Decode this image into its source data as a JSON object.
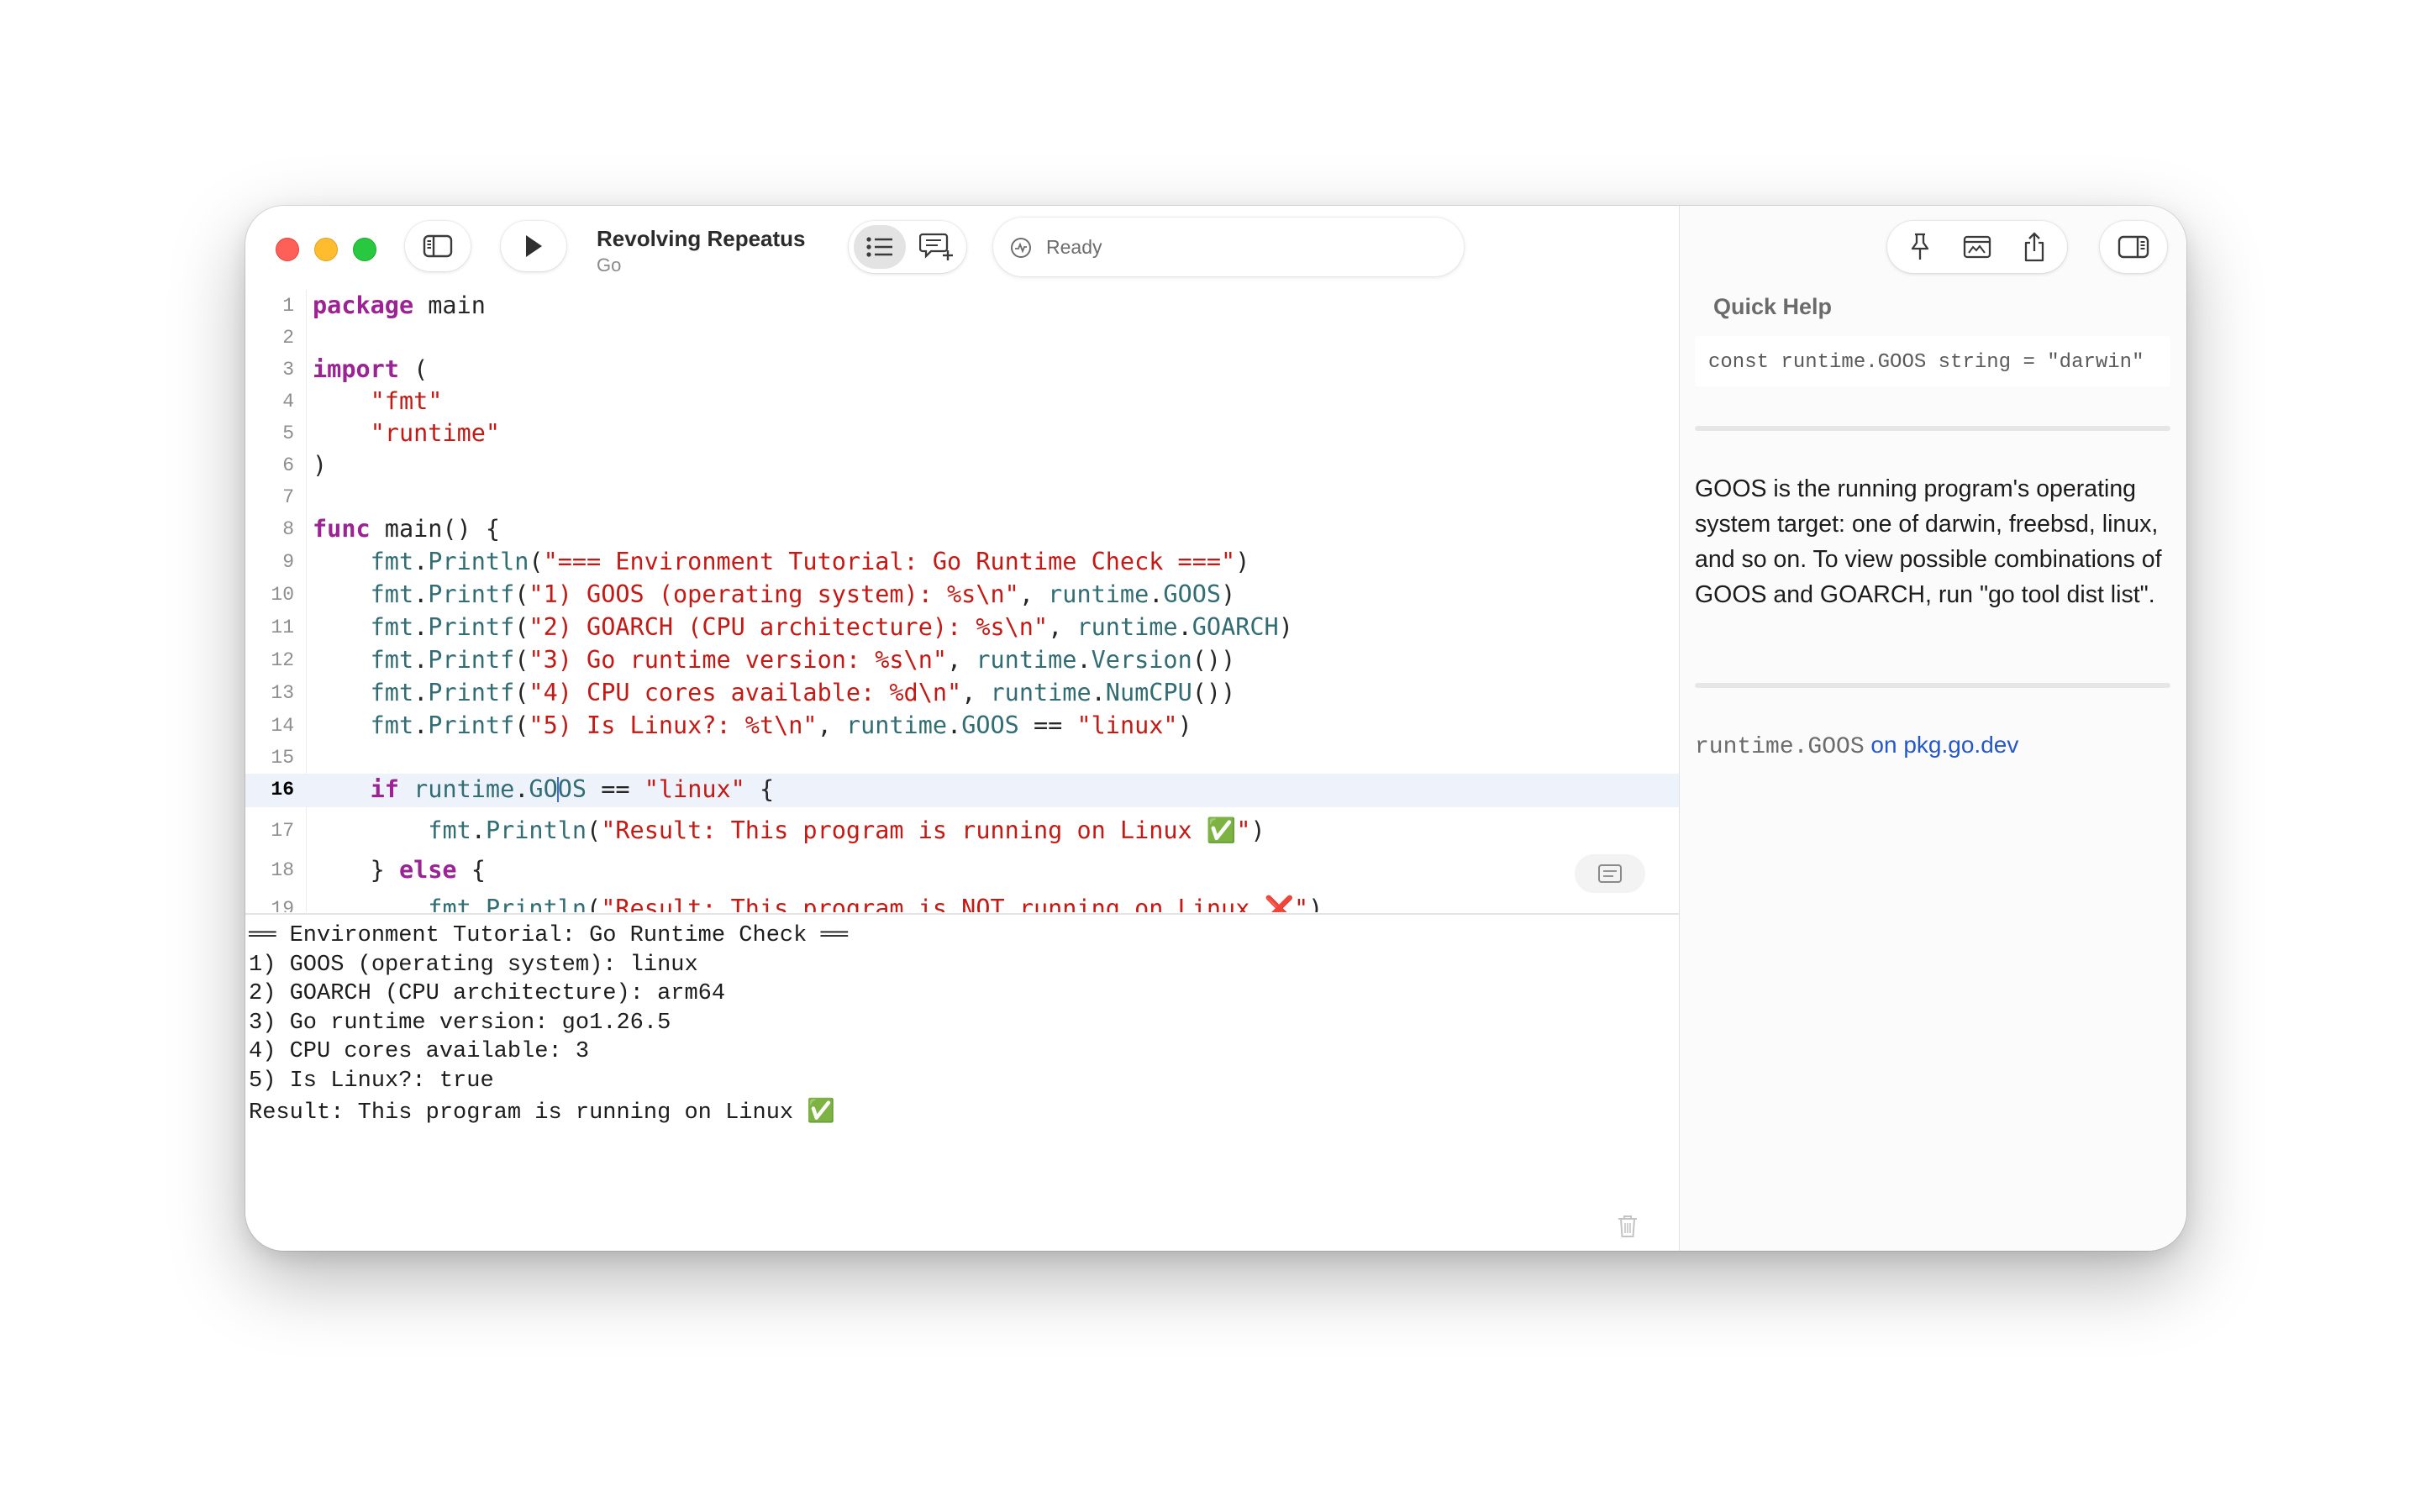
{
  "window": {
    "title": "Revolving Repeatus",
    "subtitle": "Go",
    "status": "Ready"
  },
  "editor": {
    "current_line": 16,
    "lines": [
      {
        "n": "1",
        "parts": [
          {
            "t": "package",
            "c": "kw"
          },
          {
            "t": " main"
          }
        ]
      },
      {
        "n": "2",
        "parts": []
      },
      {
        "n": "3",
        "parts": [
          {
            "t": "import",
            "c": "kw"
          },
          {
            "t": " ("
          }
        ]
      },
      {
        "n": "4",
        "parts": [
          {
            "t": "    "
          },
          {
            "t": "\"fmt\"",
            "c": "str"
          }
        ]
      },
      {
        "n": "5",
        "parts": [
          {
            "t": "    "
          },
          {
            "t": "\"runtime\"",
            "c": "str"
          }
        ]
      },
      {
        "n": "6",
        "parts": [
          {
            "t": ")"
          }
        ]
      },
      {
        "n": "7",
        "parts": []
      },
      {
        "n": "8",
        "parts": [
          {
            "t": "func",
            "c": "kw"
          },
          {
            "t": " main() {"
          }
        ]
      },
      {
        "n": "9",
        "parts": [
          {
            "t": "    "
          },
          {
            "t": "fmt",
            "c": "id"
          },
          {
            "t": "."
          },
          {
            "t": "Println",
            "c": "id"
          },
          {
            "t": "("
          },
          {
            "t": "\"=== Environment Tutorial: Go Runtime Check ===\"",
            "c": "str"
          },
          {
            "t": ")"
          }
        ]
      },
      {
        "n": "10",
        "parts": [
          {
            "t": "    "
          },
          {
            "t": "fmt",
            "c": "id"
          },
          {
            "t": "."
          },
          {
            "t": "Printf",
            "c": "id"
          },
          {
            "t": "("
          },
          {
            "t": "\"1) GOOS (operating system): %s\\n\"",
            "c": "str"
          },
          {
            "t": ", "
          },
          {
            "t": "runtime",
            "c": "id"
          },
          {
            "t": "."
          },
          {
            "t": "GOOS",
            "c": "id"
          },
          {
            "t": ")"
          }
        ]
      },
      {
        "n": "11",
        "parts": [
          {
            "t": "    "
          },
          {
            "t": "fmt",
            "c": "id"
          },
          {
            "t": "."
          },
          {
            "t": "Printf",
            "c": "id"
          },
          {
            "t": "("
          },
          {
            "t": "\"2) GOARCH (CPU architecture): %s\\n\"",
            "c": "str"
          },
          {
            "t": ", "
          },
          {
            "t": "runtime",
            "c": "id"
          },
          {
            "t": "."
          },
          {
            "t": "GOARCH",
            "c": "id"
          },
          {
            "t": ")"
          }
        ]
      },
      {
        "n": "12",
        "parts": [
          {
            "t": "    "
          },
          {
            "t": "fmt",
            "c": "id"
          },
          {
            "t": "."
          },
          {
            "t": "Printf",
            "c": "id"
          },
          {
            "t": "("
          },
          {
            "t": "\"3) Go runtime version: %s\\n\"",
            "c": "str"
          },
          {
            "t": ", "
          },
          {
            "t": "runtime",
            "c": "id"
          },
          {
            "t": "."
          },
          {
            "t": "Version",
            "c": "id"
          },
          {
            "t": "())"
          }
        ]
      },
      {
        "n": "13",
        "parts": [
          {
            "t": "    "
          },
          {
            "t": "fmt",
            "c": "id"
          },
          {
            "t": "."
          },
          {
            "t": "Printf",
            "c": "id"
          },
          {
            "t": "("
          },
          {
            "t": "\"4) CPU cores available: %d\\n\"",
            "c": "str"
          },
          {
            "t": ", "
          },
          {
            "t": "runtime",
            "c": "id"
          },
          {
            "t": "."
          },
          {
            "t": "NumCPU",
            "c": "id"
          },
          {
            "t": "())"
          }
        ]
      },
      {
        "n": "14",
        "parts": [
          {
            "t": "    "
          },
          {
            "t": "fmt",
            "c": "id"
          },
          {
            "t": "."
          },
          {
            "t": "Printf",
            "c": "id"
          },
          {
            "t": "("
          },
          {
            "t": "\"5) Is Linux?: %t\\n\"",
            "c": "str"
          },
          {
            "t": ", "
          },
          {
            "t": "runtime",
            "c": "id"
          },
          {
            "t": "."
          },
          {
            "t": "GOOS",
            "c": "id"
          },
          {
            "t": " == "
          },
          {
            "t": "\"linux\"",
            "c": "str"
          },
          {
            "t": ")"
          }
        ]
      },
      {
        "n": "15",
        "parts": []
      },
      {
        "n": "16",
        "parts": [
          {
            "t": "    "
          },
          {
            "t": "if",
            "c": "kw"
          },
          {
            "t": " "
          },
          {
            "t": "runtime",
            "c": "id"
          },
          {
            "t": "."
          },
          {
            "t": "GO",
            "c": "id"
          },
          {
            "caret": true
          },
          {
            "t": "OS",
            "c": "id"
          },
          {
            "t": " == "
          },
          {
            "t": "\"linux\"",
            "c": "str"
          },
          {
            "t": " {"
          }
        ]
      },
      {
        "n": "17",
        "parts": [
          {
            "t": "        "
          },
          {
            "t": "fmt",
            "c": "id"
          },
          {
            "t": "."
          },
          {
            "t": "Println",
            "c": "id"
          },
          {
            "t": "("
          },
          {
            "t": "\"Result: This program is running on Linux ✅\"",
            "c": "str"
          },
          {
            "t": ")"
          }
        ]
      },
      {
        "n": "18",
        "parts": [
          {
            "t": "    } "
          },
          {
            "t": "else",
            "c": "kw"
          },
          {
            "t": " {"
          }
        ]
      },
      {
        "n": "19",
        "parts": [
          {
            "t": "        "
          },
          {
            "t": "fmt",
            "c": "id"
          },
          {
            "t": "."
          },
          {
            "t": "Println",
            "c": "id"
          },
          {
            "t": "("
          },
          {
            "t": "\"Result: This program is NOT running on Linux ❌\"",
            "c": "str"
          },
          {
            "t": ")"
          }
        ]
      }
    ]
  },
  "console": {
    "lines": [
      "══ Environment Tutorial: Go Runtime Check ══",
      "1) GOOS (operating system): linux",
      "2) GOARCH (CPU architecture): arm64",
      "3) Go runtime version: go1.26.5",
      "4) CPU cores available: 3",
      "5) Is Linux?: true",
      "Result: This program is running on Linux ✅"
    ]
  },
  "inspector": {
    "title": "Quick Help",
    "declaration": "const runtime.GOOS string = \"darwin\"",
    "description": "GOOS is the running program's operating system target: one of darwin, freebsd, linux, and so on. To view possible combinations of GOOS and GOARCH, run \"go tool dist list\".",
    "link_symbol": "runtime.GOOS",
    "link_text": "on pkg.go.dev"
  },
  "icons": {
    "sidebar": "sidebar-left-icon",
    "run": "play-icon",
    "list": "list-bullet-icon",
    "comment": "comment-add-icon",
    "status": "activity-icon",
    "pin": "pin-icon",
    "preview": "preview-icon",
    "share": "share-icon",
    "inspector": "sidebar-right-icon",
    "trash": "trash-icon"
  },
  "colors": {
    "keyword": "#9b2393",
    "string": "#c41a16",
    "identifier": "#326d74",
    "link": "#2458c8",
    "current_line_bg": "#eef3fb"
  }
}
